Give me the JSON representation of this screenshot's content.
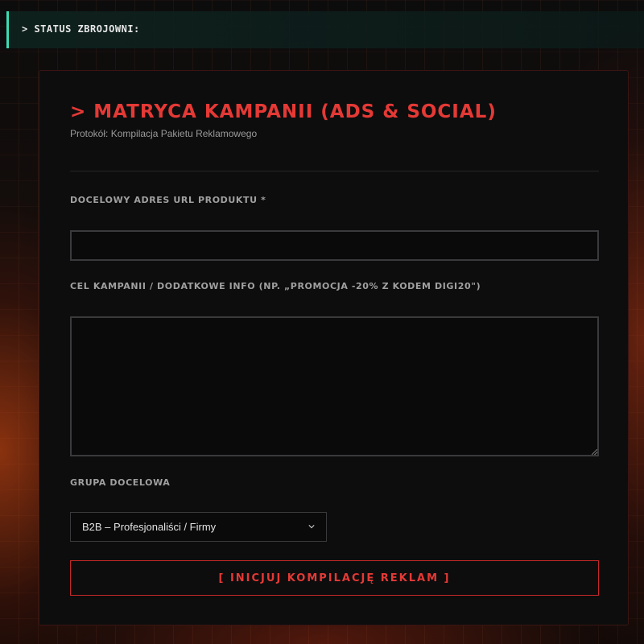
{
  "status": {
    "text": "> STATUS ZBROJOWNI:"
  },
  "form": {
    "title": "> MATRYCA KAMPANII (ADS & SOCIAL)",
    "subtitle": "Protokół: Kompilacja Pakietu Reklamowego",
    "url_field": {
      "label": "DOCELOWY ADRES URL PRODUKTU *",
      "value": "",
      "placeholder": ""
    },
    "goal_field": {
      "label": "CEL KAMPANII / DODATKOWE INFO (NP. „PROMOCJA -20% Z KODEM DIGI20\")",
      "value": "",
      "placeholder": ""
    },
    "audience_field": {
      "label": "GRUPA DOCELOWA",
      "selected": "B2B – Profesjonaliści / Firmy"
    },
    "submit_label": "[ INICJUJ KOMPILACJĘ REKLAM ]"
  },
  "colors": {
    "accent": "#e53935",
    "status_accent": "#3ddbb3",
    "card_bg": "#0d0d0e",
    "field_border": "#3a3a3c"
  },
  "icons": {
    "select_arrow": "chevron-down-icon",
    "textarea_resize": "resize-grip-icon"
  }
}
